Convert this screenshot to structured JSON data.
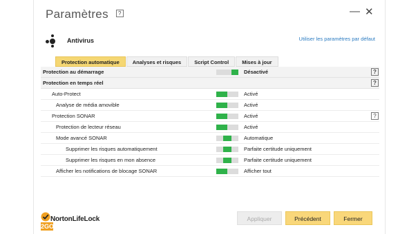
{
  "window": {
    "title": "Paramètres",
    "help_glyph": "?",
    "minimize_glyph": "—",
    "close_glyph": "✕"
  },
  "section": {
    "icon": "antivirus-icon",
    "title": "Antivirus",
    "default_link": "Utiliser les paramètres par défaut"
  },
  "tabs": [
    {
      "label": "Protection automatique",
      "active": true
    },
    {
      "label": "Analyses et risques",
      "active": false
    },
    {
      "label": "Script Control",
      "active": false
    },
    {
      "label": "Mises à jour",
      "active": false
    }
  ],
  "rows": [
    {
      "label": "Protection au démarrage",
      "status": "Désactivé",
      "help": "?",
      "header": true,
      "toggle": "off"
    },
    {
      "label": "Protection en temps réel",
      "status": "",
      "help": "?",
      "header": true,
      "toggle": "none"
    },
    {
      "label": "Auto-Protect",
      "status": "Activé",
      "help": "",
      "header": false,
      "toggle": "on"
    },
    {
      "label": "Analyse de média amovible",
      "status": "Activé",
      "help": "",
      "header": false,
      "toggle": "on"
    },
    {
      "label": "Protection SONAR",
      "status": "Activé",
      "help": "?",
      "header": false,
      "toggle": "on"
    },
    {
      "label": "Protection de lecteur réseau",
      "status": "Activé",
      "help": "",
      "header": false,
      "toggle": "on"
    },
    {
      "label": "Mode avancé SONAR",
      "status": "Automatique",
      "help": "",
      "header": false,
      "toggle": "mid"
    },
    {
      "label": "Supprimer les risques automatiquement",
      "status": "Parfaite certitude uniquement",
      "help": "",
      "header": false,
      "toggle": "mid"
    },
    {
      "label": "Supprimer les risques en mon absence",
      "status": "Parfaite certitude uniquement",
      "help": "",
      "header": false,
      "toggle": "mid"
    },
    {
      "label": "Afficher les notifications de blocage SONAR",
      "status": "Afficher tout",
      "help": "",
      "header": false,
      "toggle": "on"
    }
  ],
  "footer": {
    "logo_brand": "NortonLifeLock",
    "logo_badge": "2GO",
    "apply_label": "Appliquer",
    "prev_label": "Précédent",
    "close_label": "Fermer"
  },
  "colors": {
    "accent": "#f9d77a",
    "toggle_on": "#2fb24a",
    "toggle_off": "#dcdcdc",
    "link": "#2b7bc1"
  }
}
